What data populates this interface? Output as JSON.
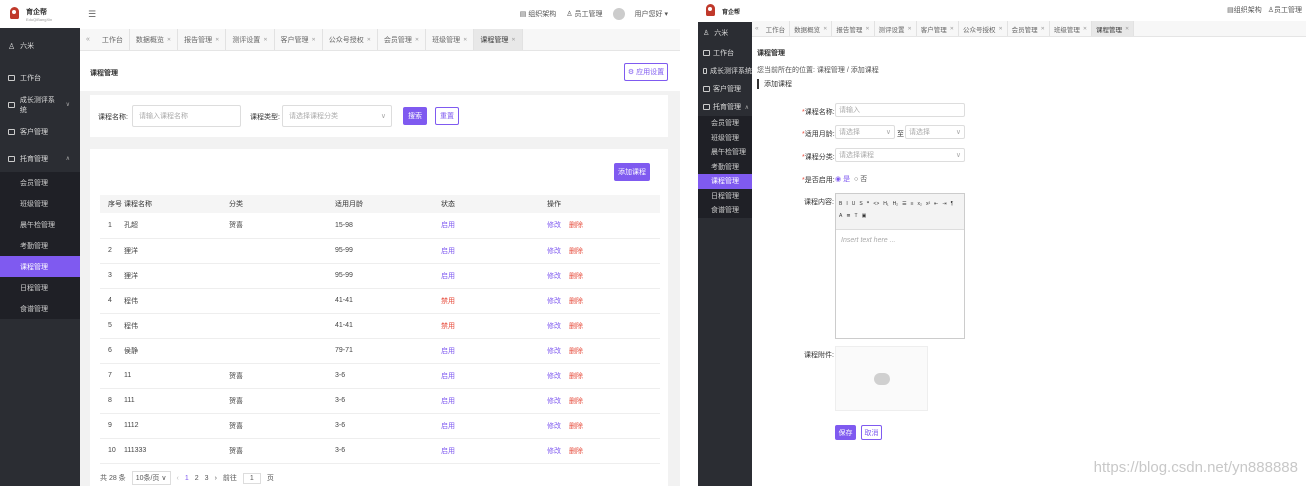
{
  "left": {
    "logo": {
      "name": "育企帮",
      "sub": "EduQiBangXin"
    },
    "header": {
      "menu_icon": "menu-fold-icon",
      "org": "组织架构",
      "staff": "员工管理",
      "user": "用户您好"
    },
    "sidebar": {
      "user": "六米",
      "items": [
        {
          "label": "工作台"
        },
        {
          "label": "成长测评系统"
        },
        {
          "label": "客户管理"
        },
        {
          "label": "托育管理"
        }
      ],
      "sub": [
        "会员管理",
        "班级管理",
        "晨午检管理",
        "考勤管理",
        "课程管理",
        "日程管理",
        "食谱管理"
      ]
    },
    "tabs": [
      "工作台",
      "数据概览",
      "报告管理",
      "测评设置",
      "客户管理",
      "公众号授权",
      "会员管理",
      "班级管理",
      "课程管理"
    ],
    "page_title": "课程管理",
    "app_settings": "应用设置",
    "filter": {
      "name_label": "课程名称:",
      "name_placeholder": "请输入课程名称",
      "type_label": "课程类型:",
      "type_placeholder": "请选择课程分类",
      "search": "搜索",
      "reset": "重置"
    },
    "add_course": "添加课程",
    "table": {
      "headers": [
        "序号",
        "课程名称",
        "分类",
        "适用月龄",
        "状态",
        "操作"
      ],
      "rows": [
        {
          "no": "1",
          "name": "孔超",
          "cat": "贺喜",
          "age": "15-98",
          "status": "启用"
        },
        {
          "no": "2",
          "name": "狸洋",
          "cat": "",
          "age": "95-99",
          "status": "启用"
        },
        {
          "no": "3",
          "name": "狸洋",
          "cat": "",
          "age": "95-99",
          "status": "启用"
        },
        {
          "no": "4",
          "name": "程伟",
          "cat": "",
          "age": "41-41",
          "status": "禁用"
        },
        {
          "no": "5",
          "name": "程伟",
          "cat": "",
          "age": "41-41",
          "status": "禁用"
        },
        {
          "no": "6",
          "name": "侯静",
          "cat": "",
          "age": "79-71",
          "status": "启用"
        },
        {
          "no": "7",
          "name": "11",
          "cat": "贺喜",
          "age": "3-6",
          "status": "启用"
        },
        {
          "no": "8",
          "name": "111",
          "cat": "贺喜",
          "age": "3-6",
          "status": "启用"
        },
        {
          "no": "9",
          "name": "1112",
          "cat": "贺喜",
          "age": "3-6",
          "status": "启用"
        },
        {
          "no": "10",
          "name": "111333",
          "cat": "贺喜",
          "age": "3-6",
          "status": "启用"
        }
      ],
      "edit": "修改",
      "delete": "删除"
    },
    "pager": {
      "total": "共 28 条",
      "size": "10条/页",
      "p1": "1",
      "p2": "2",
      "p3": "3",
      "goto": "前往",
      "page": "1",
      "unit": "页"
    }
  },
  "right": {
    "logo": {
      "name": "育企帮"
    },
    "header": {
      "org": "组织架构",
      "staff": "员工管理"
    },
    "sidebar": {
      "user": "六米",
      "items": [
        {
          "label": "工作台"
        },
        {
          "label": "成长测评系统"
        },
        {
          "label": "客户管理"
        },
        {
          "label": "托育管理"
        }
      ],
      "sub": [
        "会员管理",
        "班级管理",
        "晨午检管理",
        "考勤管理",
        "课程管理",
        "日程管理",
        "食谱管理"
      ]
    },
    "tabs": [
      "工作台",
      "数据概览",
      "报告管理",
      "测评设置",
      "客户管理",
      "公众号授权",
      "会员管理",
      "班级管理",
      "课程管理"
    ],
    "page_title": "课程管理",
    "breadcrumb": {
      "prefix": "您当前所在的位置:",
      "path": "课程管理 / 添加课程"
    },
    "section": "添加课程",
    "form": {
      "name_label": "课程名称:",
      "name_placeholder": "请输入",
      "age_label": "适用月龄:",
      "age_placeholder": "请选择",
      "to": "至",
      "age_placeholder2": "请选择",
      "cat_label": "课程分类:",
      "cat_placeholder": "请选择课程",
      "enable_label": "是否启用:",
      "yes": "是",
      "no": "否",
      "content_label": "课程内容:",
      "editor_placeholder": "Insert text here ...",
      "attach_label": "课程附件:",
      "save": "保存",
      "cancel": "取消"
    },
    "watermark": "https://blog.csdn.net/yn888888"
  },
  "colors": {
    "accent": "#7f5af0",
    "danger": "#e74c3c",
    "sidebar": "#2b2d33"
  }
}
